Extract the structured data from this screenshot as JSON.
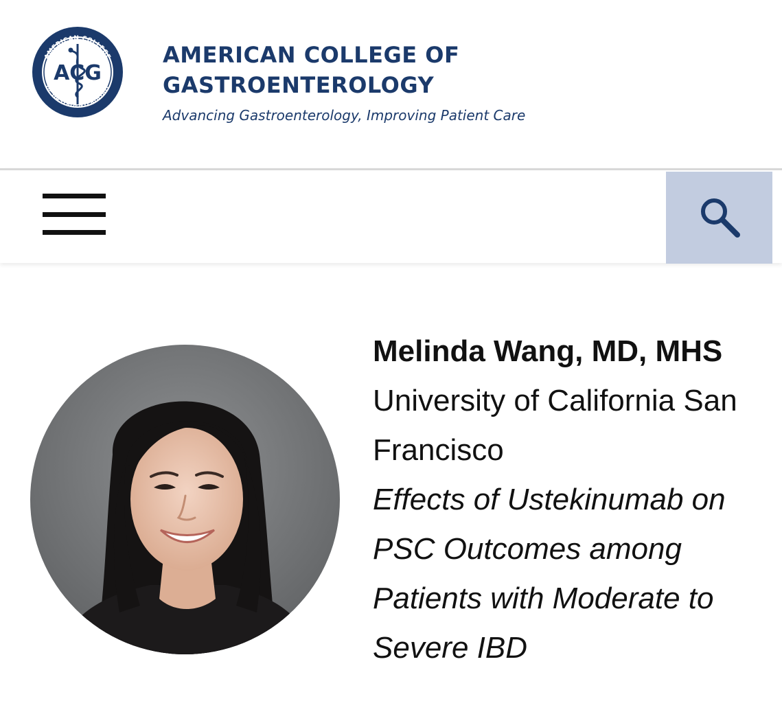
{
  "header": {
    "seal_outer_text": "AMERICAN COLLEGE OF GASTROENTEROLOGY",
    "seal_initials": "ACG",
    "brand_name": "AMERICAN COLLEGE OF\nGASTROENTEROLOGY",
    "tagline": "Advancing Gastroenterology, Improving Patient Care"
  },
  "nav": {
    "menu_icon": "hamburger-menu-icon",
    "search_icon": "search-icon"
  },
  "profile": {
    "name": "Melinda Wang, MD, MHS",
    "affiliation": "University of California San Francisco",
    "project_title": "Effects of Ustekinumab on PSC Outcomes among Patients with Moderate to Severe IBD"
  },
  "colors": {
    "brand_navy": "#1b3a6b",
    "search_bg": "#c2cce0",
    "text": "#111111"
  }
}
